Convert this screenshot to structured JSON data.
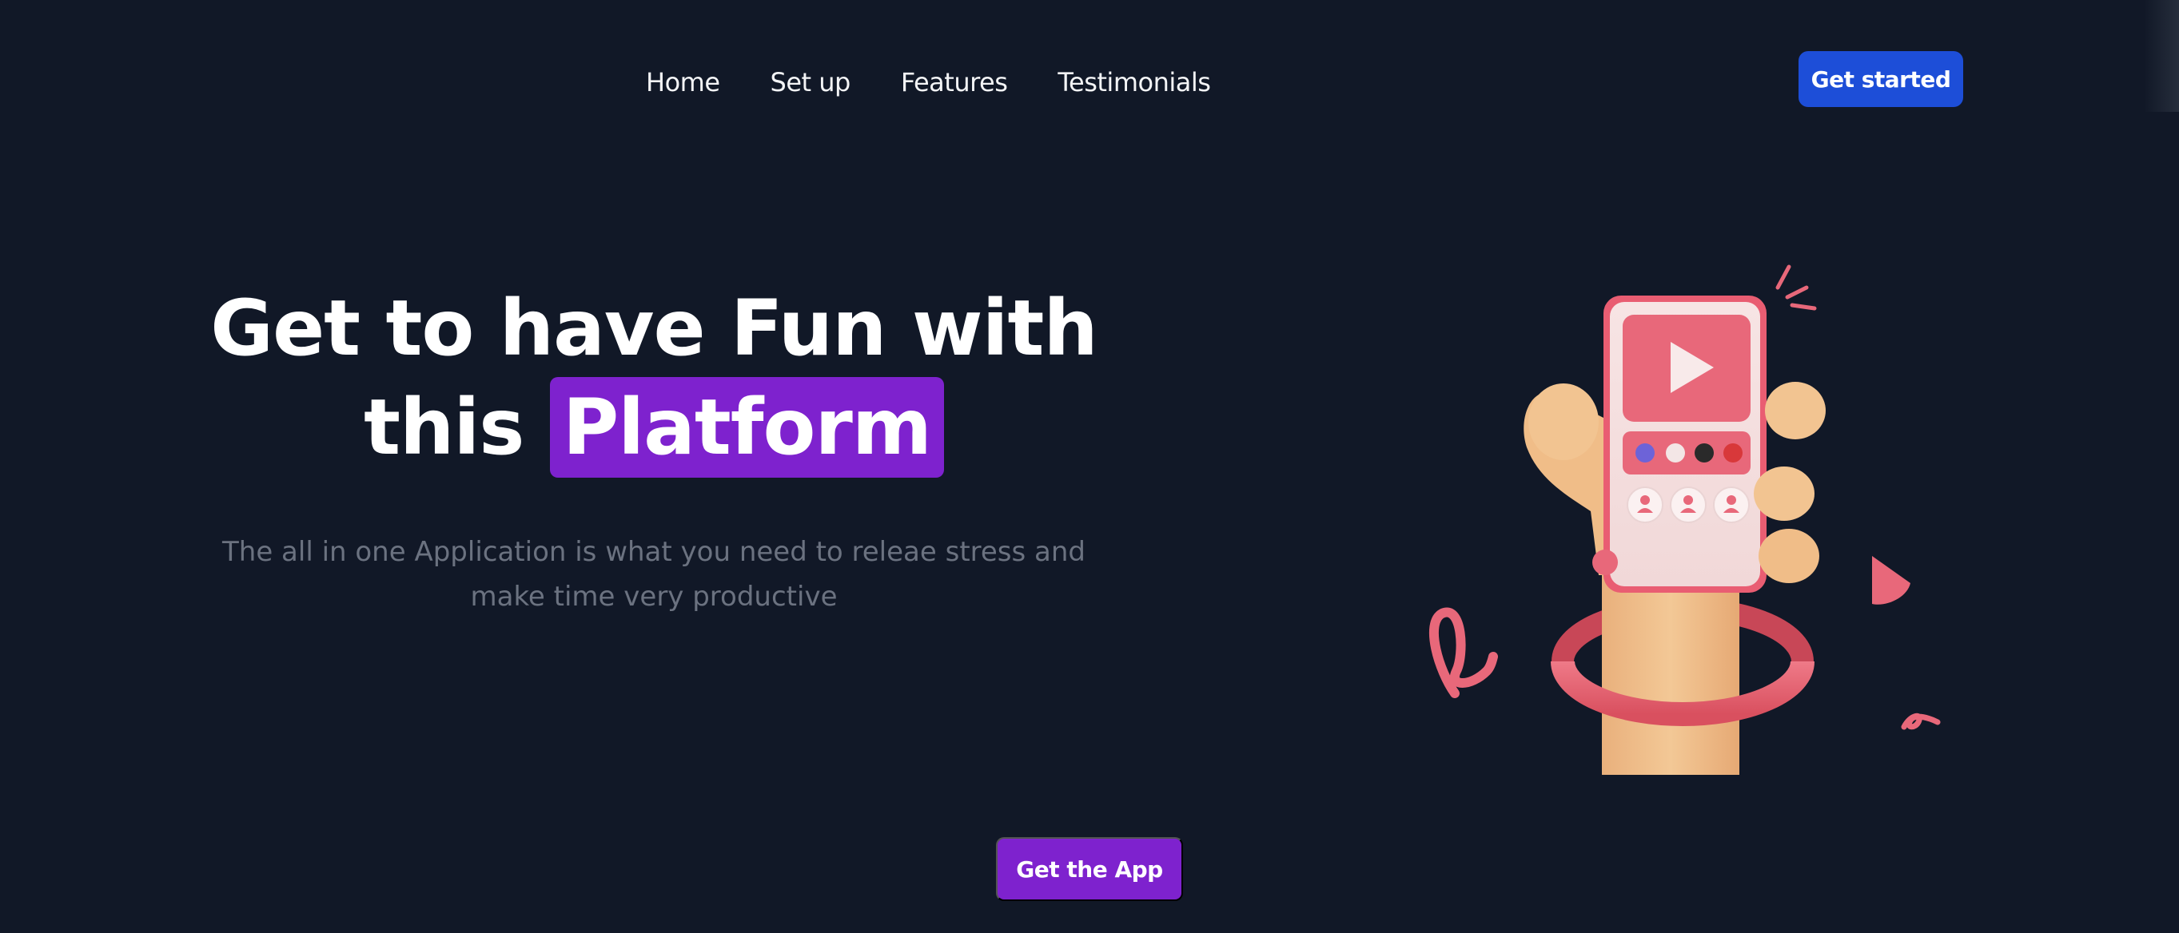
{
  "nav": {
    "items": [
      {
        "label": "Home"
      },
      {
        "label": "Set up"
      },
      {
        "label": "Features"
      },
      {
        "label": "Testimonials"
      }
    ],
    "cta_label": "Get started"
  },
  "hero": {
    "title_line1": "Get to have Fun with",
    "title_line2_prefix": "this",
    "title_highlight": "Platform",
    "subtitle": "The all in one Application is what you need to releae stress and make time very productive",
    "cta_label": "Get the App"
  },
  "colors": {
    "background": "#111827",
    "accent_blue": "#1d4ed8",
    "accent_purple": "#7e22ce",
    "illustration_pink": "#e8687a",
    "hand_skin": "#f0c08e"
  },
  "illustration": {
    "icons": [
      "play-icon",
      "user-icon"
    ]
  }
}
